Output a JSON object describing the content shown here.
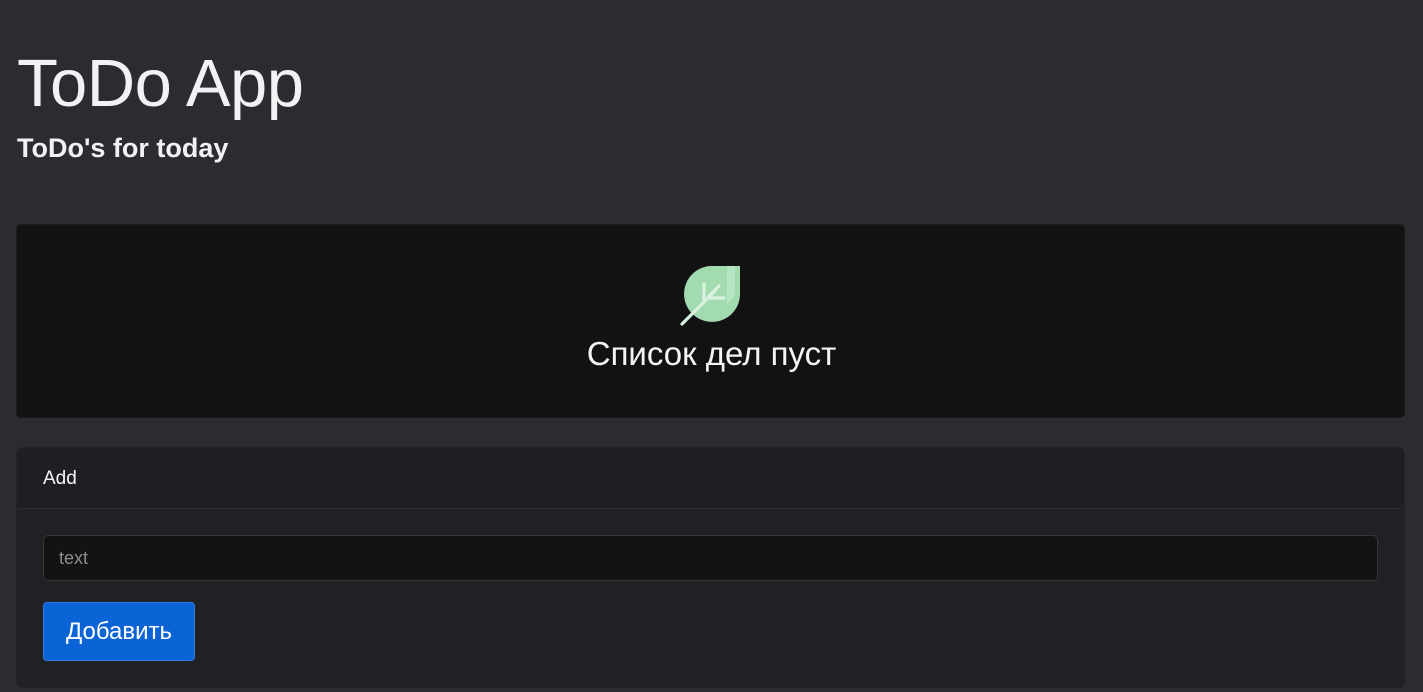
{
  "header": {
    "title": "ToDo App",
    "subtitle": "ToDo's for today"
  },
  "empty_state": {
    "icon": "leaf-icon",
    "message": "Список дел пуст",
    "icon_color": "#a3dbb0"
  },
  "add_card": {
    "header_label": "Add",
    "input": {
      "value": "",
      "placeholder": "text"
    },
    "button_label": "Добавить",
    "button_color": "#0b64d6"
  }
}
